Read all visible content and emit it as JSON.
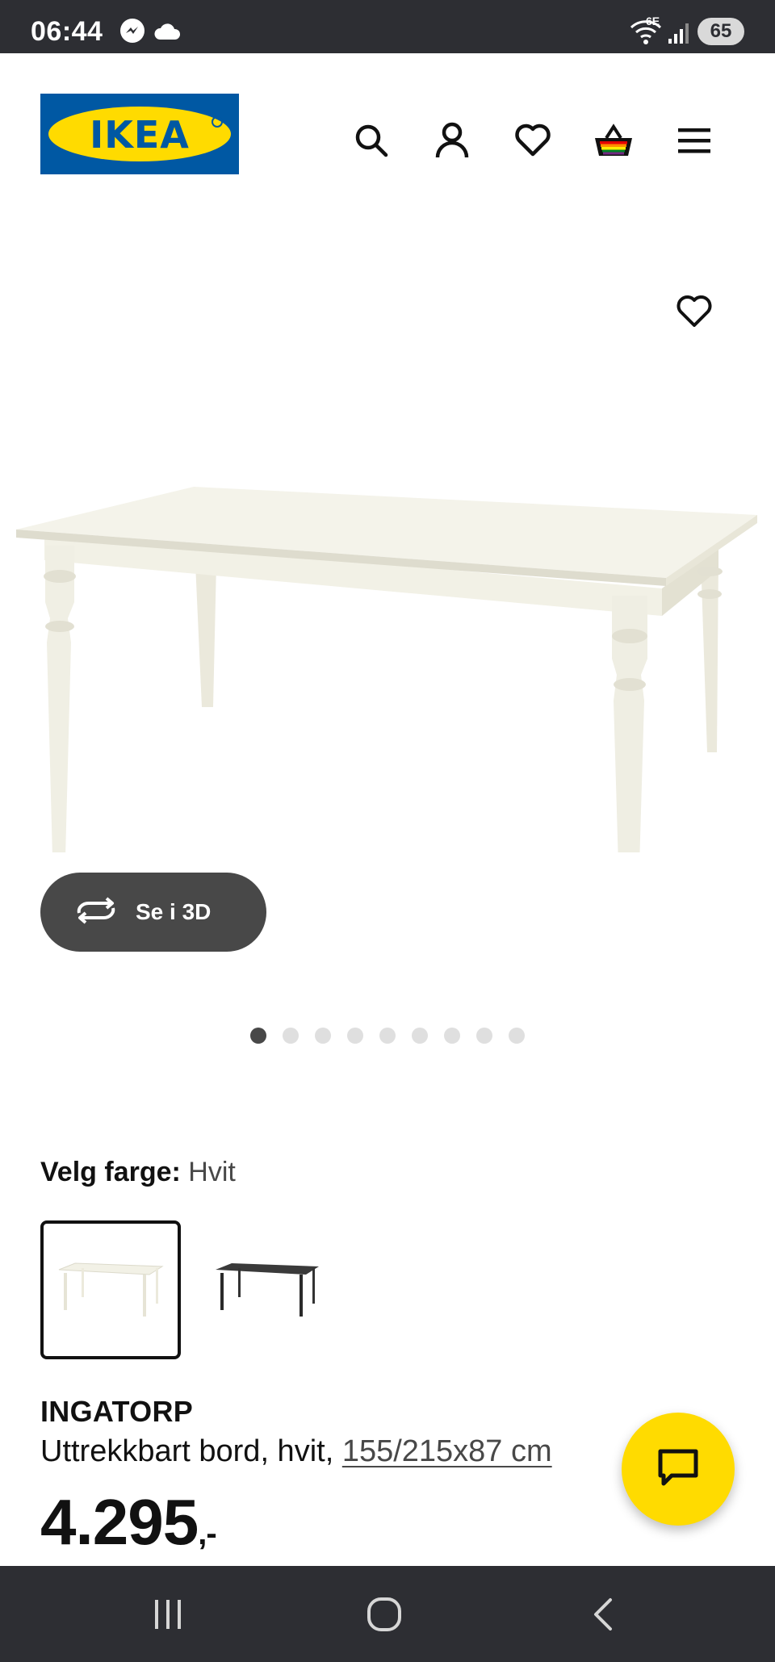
{
  "status_bar": {
    "time": "06:44",
    "network": "6E",
    "battery": "65"
  },
  "header": {
    "logo_text": "IKEA",
    "icons": [
      "search-icon",
      "user-icon",
      "heart-icon",
      "basket-icon",
      "menu-icon"
    ]
  },
  "gallery": {
    "view_3d_label": "Se i 3D",
    "dots_total": 9,
    "active_index": 0
  },
  "color_picker": {
    "label": "Velg farge:",
    "value": "Hvit",
    "options": [
      "Hvit",
      "Svart"
    ]
  },
  "product": {
    "name": "INGATORP",
    "description": "Uttrekkbart bord, hvit,",
    "dimensions": "155/215x87 cm",
    "price": "4.295",
    "price_suffix": ",-"
  },
  "colors": {
    "ikea_blue": "#0058a3",
    "ikea_yellow": "#ffdb00",
    "dark": "#484848",
    "system_bar": "#2d2e33"
  }
}
